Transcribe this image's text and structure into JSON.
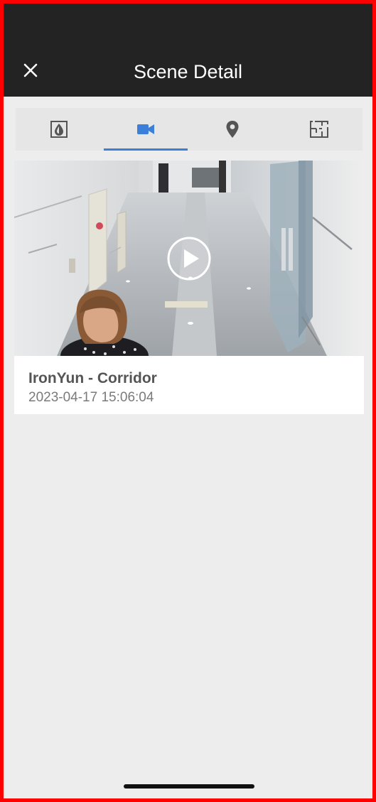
{
  "header": {
    "title": "Scene Detail",
    "close_icon": "close-icon"
  },
  "tabs": [
    {
      "icon": "drop-icon",
      "active": false
    },
    {
      "icon": "video-camera-icon",
      "active": true
    },
    {
      "icon": "location-pin-icon",
      "active": false
    },
    {
      "icon": "floor-plan-icon",
      "active": false
    }
  ],
  "colors": {
    "header_bg": "#232323",
    "accent": "#3b7fd9",
    "page_bg": "#ededed"
  },
  "scene": {
    "camera_name": "IronYun - Corridor",
    "timestamp": "2023-04-17 15:06:04",
    "thumbnail": "corridor-camera-snapshot",
    "play_icon": "play-icon"
  }
}
